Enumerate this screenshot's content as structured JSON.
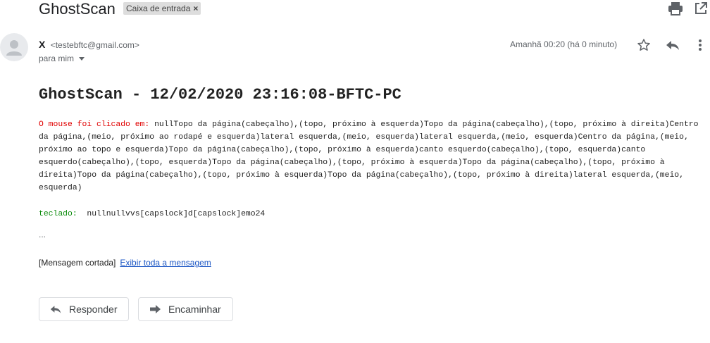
{
  "header": {
    "subject": "GhostScan",
    "label": "Caixa de entrada",
    "label_remove": "×"
  },
  "message": {
    "sender_name": "X",
    "sender_email": "<testebftc@gmail.com>",
    "recipient": "para mim",
    "date": "Amanhã 00:20 (há 0 minuto)"
  },
  "body": {
    "title": "GhostScan - 12/02/2020 23:16:08-BFTC-PC",
    "mouse_label": "O mouse foi clicado em:",
    "mouse_text": "nullTopo da página(cabeçalho),(topo, próximo à esquerda)Topo da página(cabeçalho),(topo, próximo à direita)Centro da página,(meio, próximo ao rodapé e esquerda)lateral esquerda,(meio, esquerda)lateral esquerda,(meio, esquerda)Centro da página,(meio, próximo ao topo e esquerda)Topo da página(cabeçalho),(topo, próximo à esquerda)canto esquerdo(cabeçalho),(topo, esquerda)canto esquerdo(cabeçalho),(topo, esquerda)Topo da página(cabeçalho),(topo, próximo à esquerda)Topo da página(cabeçalho),(topo, próximo à direita)Topo da página(cabeçalho),(topo, próximo à esquerda)Topo da página(cabeçalho),(topo, próximo à direita)lateral esquerda,(meio, esquerda)",
    "keyboard_label": "teclado:",
    "keyboard_text": "nullnullvvs[capslock]d[capslock]emo24",
    "ellipsis": "...",
    "truncated_text": "[Mensagem cortada]",
    "view_full_link": "Exibir toda a mensagem"
  },
  "actions": {
    "reply_label": "Responder",
    "forward_label": "Encaminhar"
  },
  "colors": {
    "mouse_label": "#e00000",
    "keyboard_label": "#0a8a0a",
    "link": "#1a55c4"
  }
}
